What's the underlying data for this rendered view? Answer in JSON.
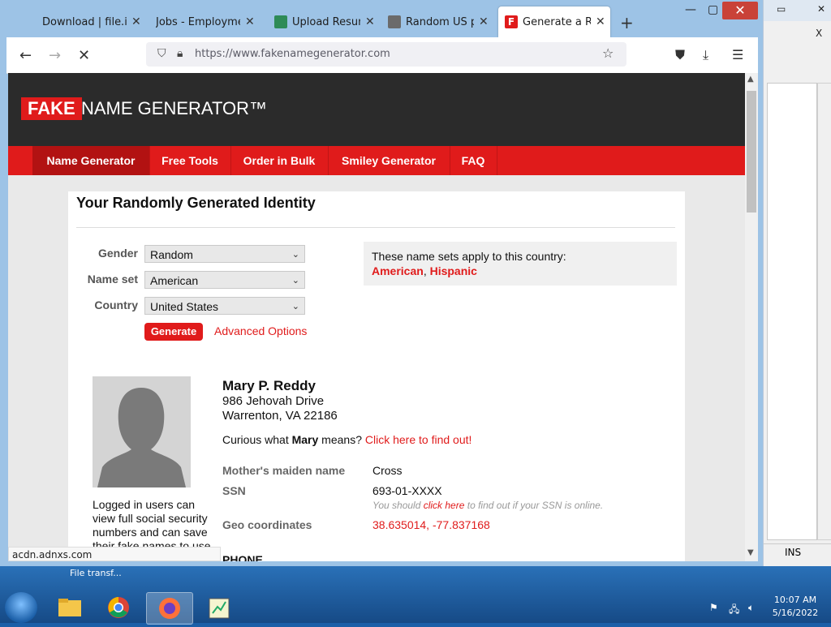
{
  "browser": {
    "tabs": [
      {
        "label": "Download | file.io",
        "active": false
      },
      {
        "label": "Jobs - Employment",
        "active": false
      },
      {
        "label": "Upload Resume",
        "active": false
      },
      {
        "label": "Random US pho",
        "active": false
      },
      {
        "label": "Generate a Rand",
        "active": true
      }
    ],
    "url": "https://www.fakenamegenerator.com",
    "status_url": "acdn.adnxs.com"
  },
  "site": {
    "logo_fake": "FAKE",
    "logo_rest": "NAME GENERATOR™",
    "menu": [
      "Name Generator",
      "Free Tools",
      "Order in Bulk",
      "Smiley Generator",
      "FAQ"
    ],
    "card_title": "Your Randomly Generated Identity",
    "form": {
      "gender_label": "Gender",
      "gender_value": "Random",
      "nameset_label": "Name set",
      "nameset_value": "American",
      "country_label": "Country",
      "country_value": "United States",
      "generate_label": "Generate",
      "advanced_label": "Advanced Options"
    },
    "namesets_note": "These name sets apply to this country:",
    "namesets_a": "American",
    "namesets_sep": ", ",
    "namesets_b": "Hispanic",
    "logged_note": "Logged in users can view full social security numbers and can save their fake names to use later.",
    "identity": {
      "name": "Mary P. Reddy",
      "street": "986 Jehovah Drive",
      "city": "Warrenton, VA 22186",
      "curious_prefix": "Curious what ",
      "curious_name": "Mary",
      "curious_mid": " means? ",
      "curious_link": "Click here to find out!",
      "maiden_label": "Mother's maiden name",
      "maiden_value": "Cross",
      "ssn_label": "SSN",
      "ssn_value": "693-01-XXXX",
      "ssn_note_pre": "You should ",
      "ssn_note_link": "click here",
      "ssn_note_post": " to find out if your SSN is online.",
      "geo_label": "Geo coordinates",
      "geo_value": "38.635014, -77.837168",
      "phone_heading": "PHONE"
    }
  },
  "desktop": {
    "bg_status": "INS",
    "file_transfer": "File transf...",
    "clock_time": "10:07 AM",
    "clock_date": "5/16/2022"
  }
}
